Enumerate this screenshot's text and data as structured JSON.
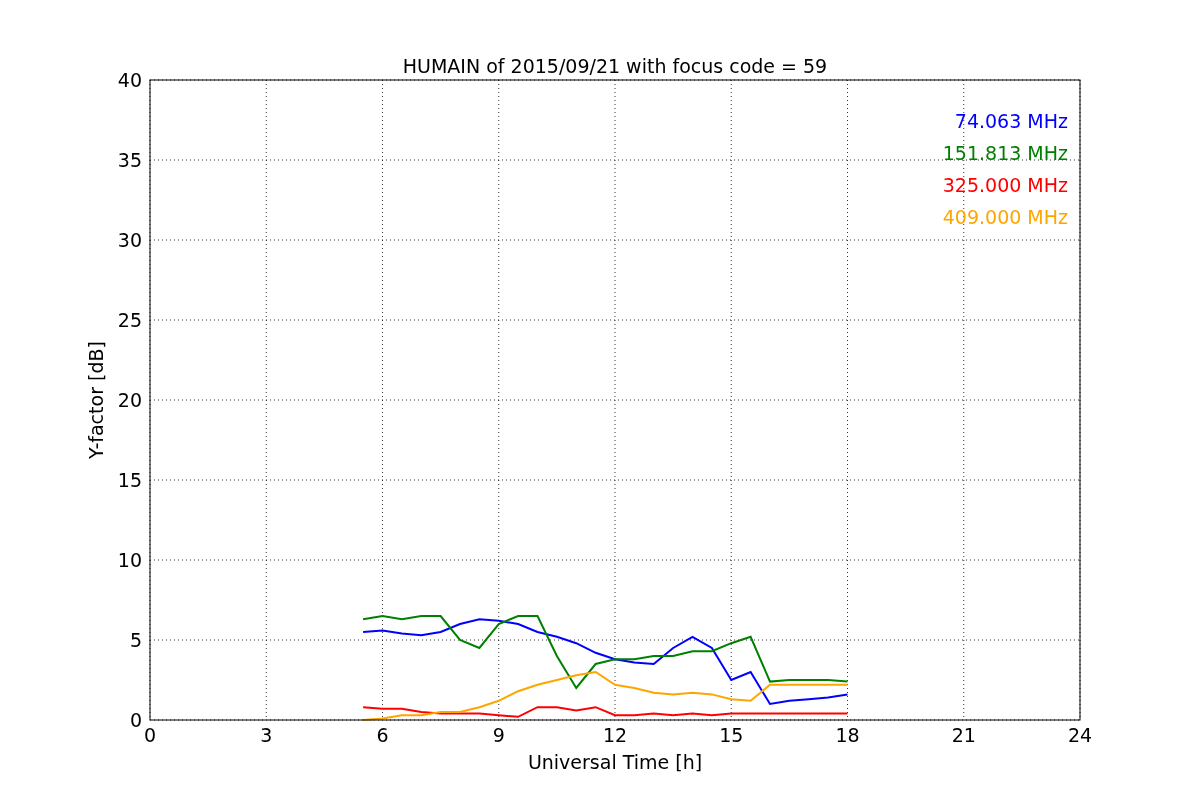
{
  "chart_data": {
    "type": "line",
    "title": "HUMAIN of 2015/09/21 with focus code = 59",
    "xlabel": "Universal Time [h]",
    "ylabel": "Y-factor [dB]",
    "x": [
      5.5,
      6,
      6.5,
      7,
      7.5,
      8,
      8.5,
      9,
      9.5,
      10,
      10.5,
      11,
      11.5,
      12,
      12.5,
      13,
      13.5,
      14,
      14.5,
      15,
      15.5,
      16,
      16.5,
      17,
      17.5,
      18
    ],
    "series": [
      {
        "name": "74.063 MHz",
        "color": "#0000ff",
        "values": [
          5.5,
          5.6,
          5.4,
          5.3,
          5.5,
          6.0,
          6.3,
          6.2,
          6.0,
          5.5,
          5.2,
          4.8,
          4.2,
          3.8,
          3.6,
          3.5,
          4.5,
          5.2,
          4.5,
          2.5,
          3.0,
          1.0,
          1.2,
          1.3,
          1.4,
          1.6
        ]
      },
      {
        "name": "151.813 MHz",
        "color": "#008000",
        "values": [
          6.3,
          6.5,
          6.3,
          6.5,
          6.5,
          5.0,
          4.5,
          6.0,
          6.5,
          6.5,
          4.0,
          2.0,
          3.5,
          3.8,
          3.8,
          4.0,
          4.0,
          4.3,
          4.3,
          4.8,
          5.2,
          2.4,
          2.5,
          2.5,
          2.5,
          2.4
        ]
      },
      {
        "name": "325.000 MHz",
        "color": "#ff0000",
        "values": [
          0.8,
          0.7,
          0.7,
          0.5,
          0.4,
          0.4,
          0.4,
          0.3,
          0.2,
          0.8,
          0.8,
          0.6,
          0.8,
          0.3,
          0.3,
          0.4,
          0.3,
          0.4,
          0.3,
          0.4,
          0.4,
          0.4,
          0.4,
          0.4,
          0.4,
          0.4
        ]
      },
      {
        "name": "409.000 MHz",
        "color": "#ffa500",
        "values": [
          0.0,
          0.1,
          0.3,
          0.3,
          0.5,
          0.5,
          0.8,
          1.2,
          1.8,
          2.2,
          2.5,
          2.8,
          3.0,
          2.2,
          2.0,
          1.7,
          1.6,
          1.7,
          1.6,
          1.3,
          1.2,
          2.2,
          2.2,
          2.2,
          2.2,
          2.2
        ]
      }
    ],
    "grid": true,
    "xlim": [
      0,
      24
    ],
    "ylim": [
      0,
      40
    ],
    "xticks": [
      0,
      3,
      6,
      9,
      12,
      15,
      18,
      21,
      24
    ],
    "yticks": [
      0,
      5,
      10,
      15,
      20,
      25,
      30,
      35,
      40
    ]
  }
}
